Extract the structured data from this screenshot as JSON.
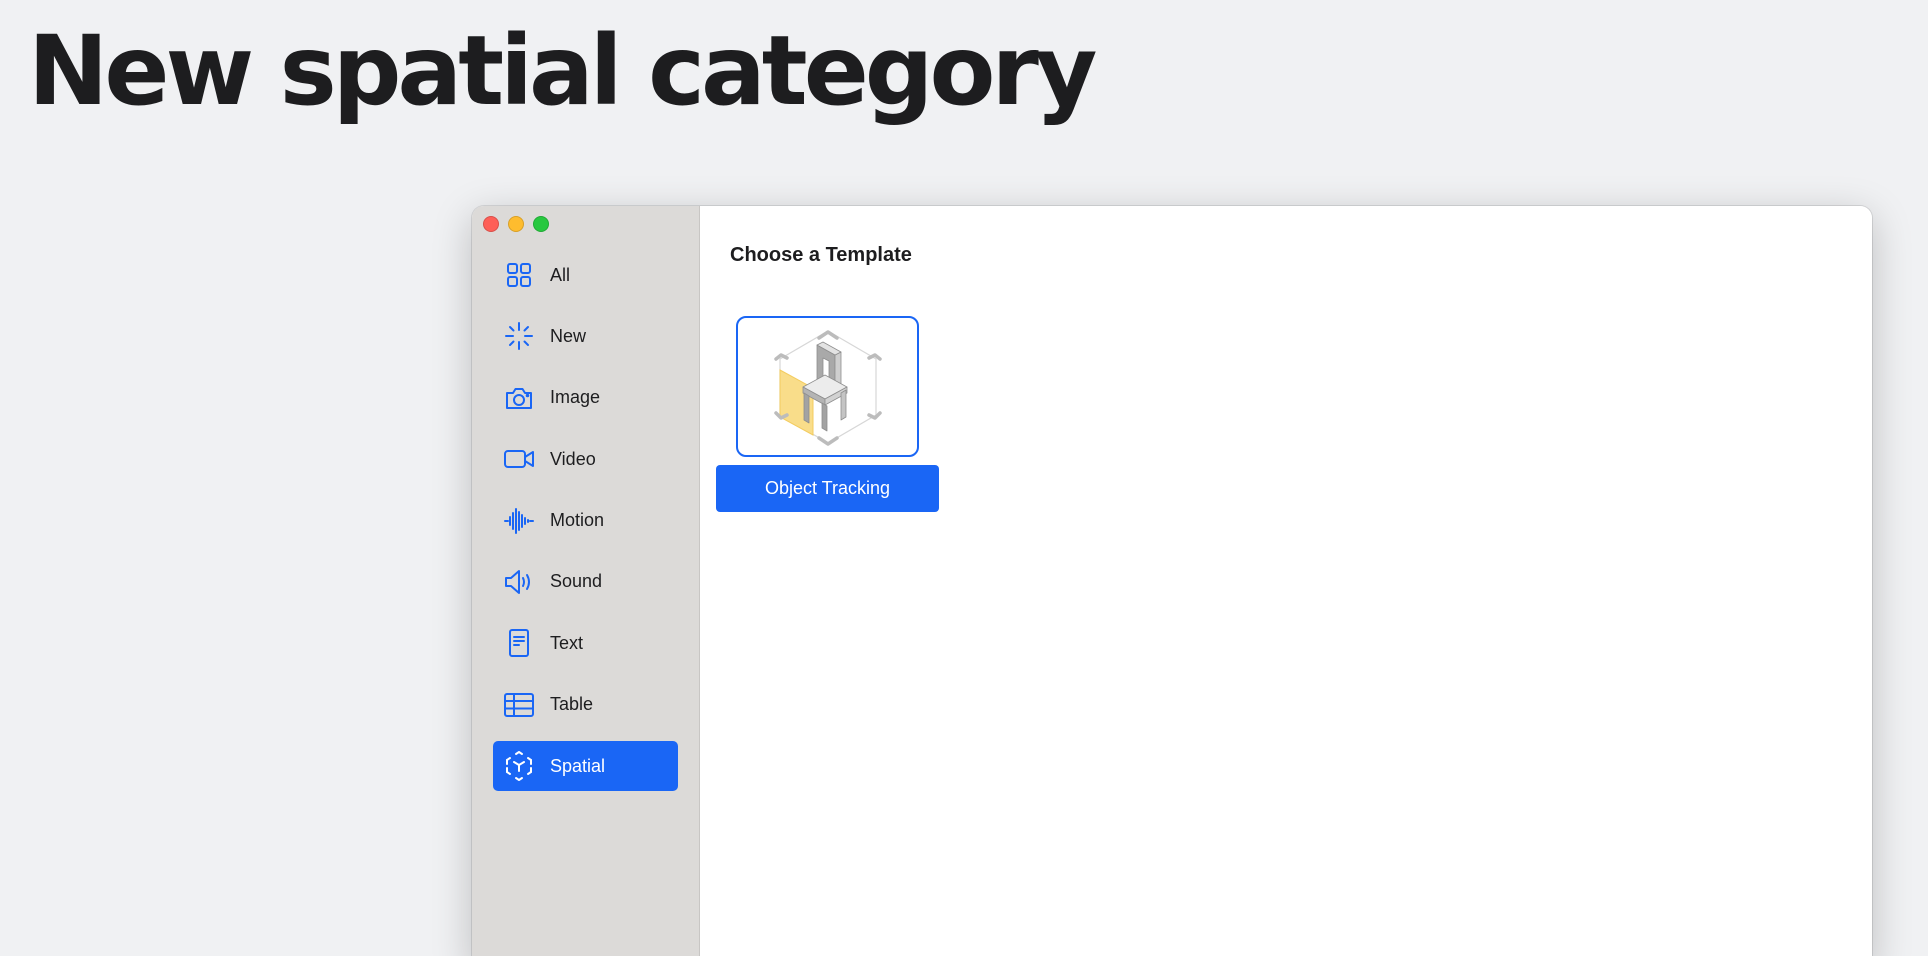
{
  "slide": {
    "title": "New spatial category"
  },
  "window": {
    "sidebar": {
      "items": [
        {
          "label": "All",
          "icon": "grid-icon",
          "active": false
        },
        {
          "label": "New",
          "icon": "sparkle-icon",
          "active": false
        },
        {
          "label": "Image",
          "icon": "camera-icon",
          "active": false
        },
        {
          "label": "Video",
          "icon": "video-camera-icon",
          "active": false
        },
        {
          "label": "Motion",
          "icon": "waveform-icon",
          "active": false
        },
        {
          "label": "Sound",
          "icon": "speaker-icon",
          "active": false
        },
        {
          "label": "Text",
          "icon": "document-text-icon",
          "active": false
        },
        {
          "label": "Table",
          "icon": "table-icon",
          "active": false
        },
        {
          "label": "Spatial",
          "icon": "spatial-cube-icon",
          "active": true
        }
      ]
    },
    "main": {
      "heading": "Choose a Template",
      "templates": [
        {
          "label": "Object Tracking",
          "icon": "chair-in-cube-icon",
          "selected": true
        }
      ]
    }
  },
  "colors": {
    "accent": "#1a66f5",
    "sidebar_bg": "#dcdad8",
    "page_bg": "#f0f1f3",
    "close": "#fe5f57",
    "minimize": "#febc2e",
    "zoom": "#28c840"
  }
}
